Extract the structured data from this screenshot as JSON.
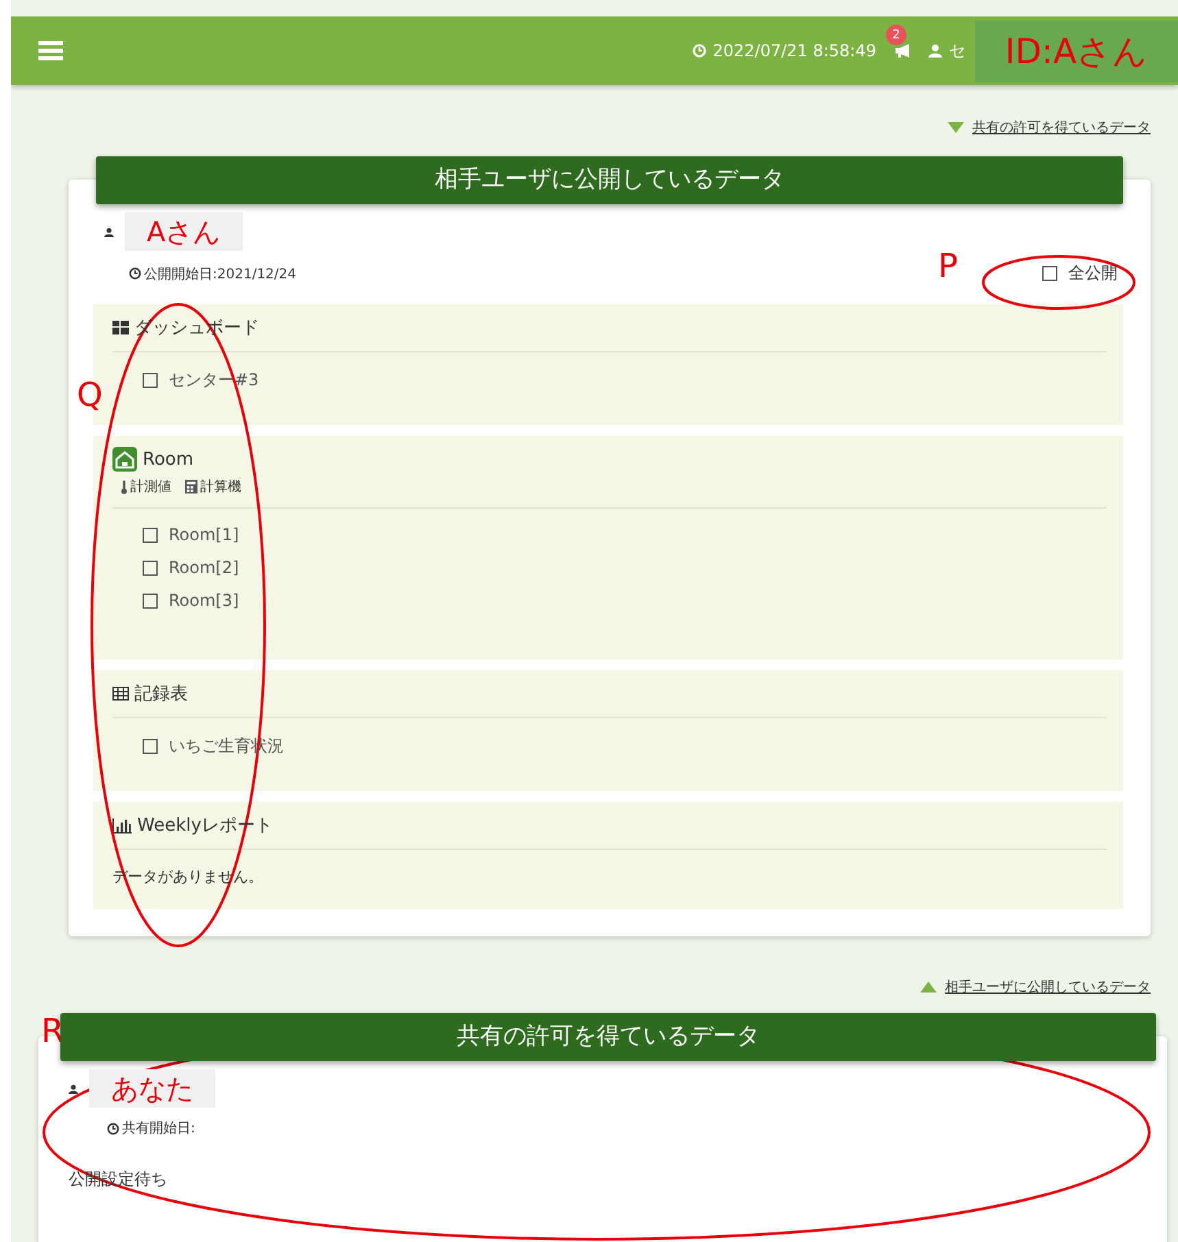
{
  "header": {
    "clock": "2022/07/21 8:58:49",
    "notification_count": "2",
    "user": "セ",
    "id_label": "ID:Aさん"
  },
  "published": {
    "jump_link": "共有の許可を得ているデータ",
    "title": "相手ユーザに公開しているデータ",
    "user_label": "Aさん",
    "start_date": "公開開始日:2021/12/24",
    "publish_all": {
      "label": "全公開",
      "checked": false
    },
    "groups": [
      {
        "kind": "dashboard",
        "title": "ダッシュボード",
        "items": [
          {
            "label": "センター#3",
            "checked": false
          }
        ]
      },
      {
        "kind": "room",
        "title": "Room",
        "subtabs": [
          "計測値",
          "計算機"
        ],
        "items": [
          {
            "label": "Room[1]",
            "checked": false
          },
          {
            "label": "Room[2]",
            "checked": false
          },
          {
            "label": "Room[3]",
            "checked": false
          }
        ]
      },
      {
        "kind": "table",
        "title": "記録表",
        "items": [
          {
            "label": "いちご生育状況",
            "checked": false
          }
        ]
      },
      {
        "kind": "report",
        "title": "Weeklyレポート",
        "empty_message": "データがありません。"
      }
    ]
  },
  "shared": {
    "jump_link": "相手ユーザに公開しているデータ",
    "title": "共有の許可を得ているデータ",
    "user_label": "あなた",
    "start_date": "共有開始日:",
    "status": "公開設定待ち"
  },
  "annotations": [
    {
      "label": "P"
    },
    {
      "label": "Q"
    },
    {
      "label": "R"
    }
  ]
}
